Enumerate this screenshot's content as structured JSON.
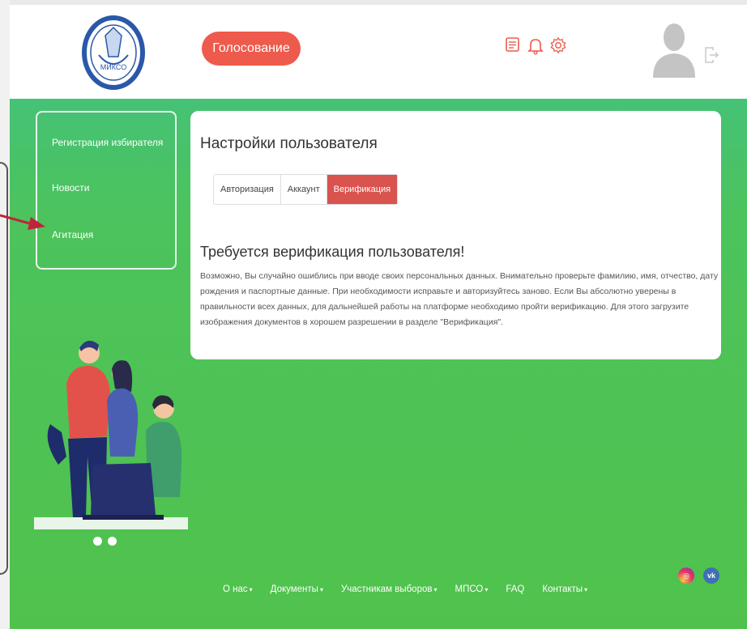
{
  "header": {
    "logo_text": "МИКСО",
    "vote_button": "Голосование",
    "icons": [
      "chat-icon",
      "bell-icon",
      "gear-icon"
    ]
  },
  "sidebar": {
    "items": [
      {
        "label": "Регистрация избирателя"
      },
      {
        "label": "Новости"
      },
      {
        "label": "Агитация"
      }
    ]
  },
  "card": {
    "title": "Настройки пользователя",
    "tabs": [
      {
        "label": "Авторизация",
        "active": false
      },
      {
        "label": "Аккаунт",
        "active": false
      },
      {
        "label": "Верификация",
        "active": true
      }
    ],
    "heading": "Требуется верификация пользователя!",
    "body": "Возможно, Вы случайно ошиблись при вводе своих персональных данных. Внимательно проверьте фамилию, имя, отчество, дату рождения и паспортные данные. При необходимости исправьте и авторизуйтесь заново. Если Вы абсолютно уверены в правильности всех данных, для дальнейшей работы на платформе необходимо пройти верификацию. Для этого загрузите изображения документов в хорошем разрешении в разделе \"Верификация\"."
  },
  "footer": {
    "nav": [
      {
        "label": "О нас"
      },
      {
        "label": "Документы"
      },
      {
        "label": "Участникам выборов"
      },
      {
        "label": "МПСО"
      },
      {
        "label": "FAQ"
      },
      {
        "label": "Контакты"
      }
    ]
  },
  "colors": {
    "accent": "#ee5a4c",
    "green_top": "#43c08a",
    "green_bottom": "#50c24c"
  }
}
